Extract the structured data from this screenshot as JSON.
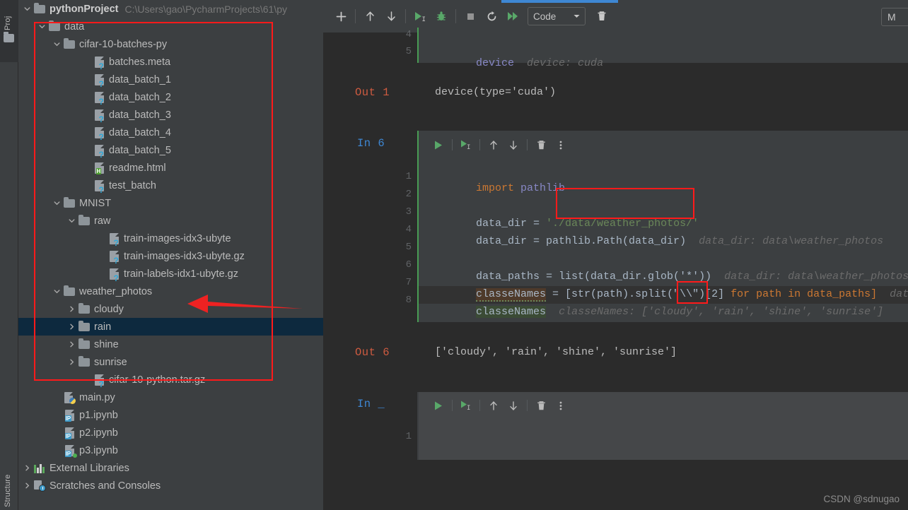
{
  "app": {
    "left_strip": {
      "project_label": "Proj",
      "structure_label": "Structure"
    },
    "watermark": "CSDN @sdnugao"
  },
  "project_tree": {
    "root": {
      "name": "pythonProject",
      "path": "C:\\Users\\gao\\PycharmProjects\\61\\py"
    },
    "items": [
      {
        "label": "data",
        "indent": 1,
        "type": "folder",
        "state": "expanded"
      },
      {
        "label": "cifar-10-batches-py",
        "indent": 2,
        "type": "folder",
        "state": "expanded"
      },
      {
        "label": "batches.meta",
        "indent": 4,
        "type": "file-q",
        "state": "leaf"
      },
      {
        "label": "data_batch_1",
        "indent": 4,
        "type": "file-q",
        "state": "leaf"
      },
      {
        "label": "data_batch_2",
        "indent": 4,
        "type": "file-q",
        "state": "leaf"
      },
      {
        "label": "data_batch_3",
        "indent": 4,
        "type": "file-q",
        "state": "leaf"
      },
      {
        "label": "data_batch_4",
        "indent": 4,
        "type": "file-q",
        "state": "leaf"
      },
      {
        "label": "data_batch_5",
        "indent": 4,
        "type": "file-q",
        "state": "leaf"
      },
      {
        "label": "readme.html",
        "indent": 4,
        "type": "file-html",
        "state": "leaf"
      },
      {
        "label": "test_batch",
        "indent": 4,
        "type": "file-q",
        "state": "leaf"
      },
      {
        "label": "MNIST",
        "indent": 2,
        "type": "folder",
        "state": "expanded"
      },
      {
        "label": "raw",
        "indent": 3,
        "type": "folder",
        "state": "expanded"
      },
      {
        "label": "train-images-idx3-ubyte",
        "indent": 5,
        "type": "file-q",
        "state": "leaf"
      },
      {
        "label": "train-images-idx3-ubyte.gz",
        "indent": 5,
        "type": "file-q",
        "state": "leaf"
      },
      {
        "label": "train-labels-idx1-ubyte.gz",
        "indent": 5,
        "type": "file-q",
        "state": "leaf"
      },
      {
        "label": "weather_photos",
        "indent": 2,
        "type": "folder",
        "state": "expanded"
      },
      {
        "label": "cloudy",
        "indent": 3,
        "type": "folder",
        "state": "collapsed"
      },
      {
        "label": "rain",
        "indent": 3,
        "type": "folder",
        "state": "collapsed",
        "selected": true
      },
      {
        "label": "shine",
        "indent": 3,
        "type": "folder",
        "state": "collapsed"
      },
      {
        "label": "sunrise",
        "indent": 3,
        "type": "folder",
        "state": "collapsed"
      },
      {
        "label": "cifar-10-python.tar.gz",
        "indent": 4,
        "type": "file-q",
        "state": "leaf"
      },
      {
        "label": "main.py",
        "indent": 2,
        "type": "file-py",
        "state": "leaf"
      },
      {
        "label": "p1.ipynb",
        "indent": 2,
        "type": "file-ipynb",
        "state": "leaf"
      },
      {
        "label": "p2.ipynb",
        "indent": 2,
        "type": "file-ipynb",
        "state": "leaf"
      },
      {
        "label": "p3.ipynb",
        "indent": 2,
        "type": "file-ipynb-run",
        "state": "leaf"
      },
      {
        "label": "External Libraries",
        "indent": 0,
        "type": "libs",
        "state": "collapsed"
      },
      {
        "label": "Scratches and Consoles",
        "indent": 0,
        "type": "scratches",
        "state": "collapsed"
      }
    ]
  },
  "notebook_toolbar": {
    "add_label": "+",
    "move_up_label": "↑",
    "move_down_label": "↓",
    "run_label": "▶",
    "debug_label": "debug-icon",
    "stop_label": "■",
    "restart_label": "restart-icon",
    "run_all_label": "»",
    "cell_type": "Code",
    "cell_type_caret": "▼",
    "delete_label": "delete-icon",
    "kernel_label": "M"
  },
  "cells": [
    {
      "id": "cell-partial-top",
      "gutter": [
        "4",
        "5"
      ],
      "line5_code": "device",
      "line5_hint": "device: cuda"
    },
    {
      "id": "cell-out-1",
      "prompt": "Out 1",
      "output": "device(type='cuda')"
    },
    {
      "id": "cell-in-6",
      "prompt": "In 6",
      "gutter": [
        "1",
        "2",
        "3",
        "4",
        "5",
        "6",
        "7",
        "8"
      ],
      "lines": {
        "l1": "import pathlib",
        "l3_a": "data_dir = ",
        "l3_str": "'./data/weather_photos/'",
        "l4_a": "data_dir = pathlib.Path(data_dir)",
        "l4_hint": "data_dir: data\\weather_photos",
        "l6_a": "data_paths = list(data_dir.glob('*'))",
        "l6_hint": "data_dir: data\\weather_photos",
        "l7_var": "classeNames",
        "l7_mid": " = [str(path).split(\"\\\\\")",
        "l7_idx": "[2]",
        "l7_for": " for path in data_paths]",
        "l7_hint": "dat",
        "l8_var": "classeNames",
        "l8_hint": "classeNames: ['cloudy', 'rain', 'shine', 'sunrise']"
      }
    },
    {
      "id": "cell-out-6",
      "prompt": "Out 6",
      "output": "['cloudy', 'rain', 'shine', 'sunrise']"
    },
    {
      "id": "cell-in-empty",
      "prompt": "In _",
      "gutter": [
        "1"
      ]
    }
  ],
  "cell_toolbar": {
    "run": "▶",
    "run_and_select": "run-and-select-icon",
    "move_up": "↑",
    "move_down": "↓",
    "delete": "delete-icon",
    "more": "⋮"
  },
  "colors": {
    "panel_bg": "#3c3f41",
    "editor_bg": "#2b2b2b",
    "cell_bg": "#3c3f41",
    "selection_blue": "#0d293e",
    "annotation_red": "#ff1a1a",
    "accent_green": "#499c54",
    "tab_blue": "#3e87d3",
    "out_orange": "#cf5b40",
    "string_green": "#6a8759",
    "keyword_orange": "#cc7832"
  }
}
